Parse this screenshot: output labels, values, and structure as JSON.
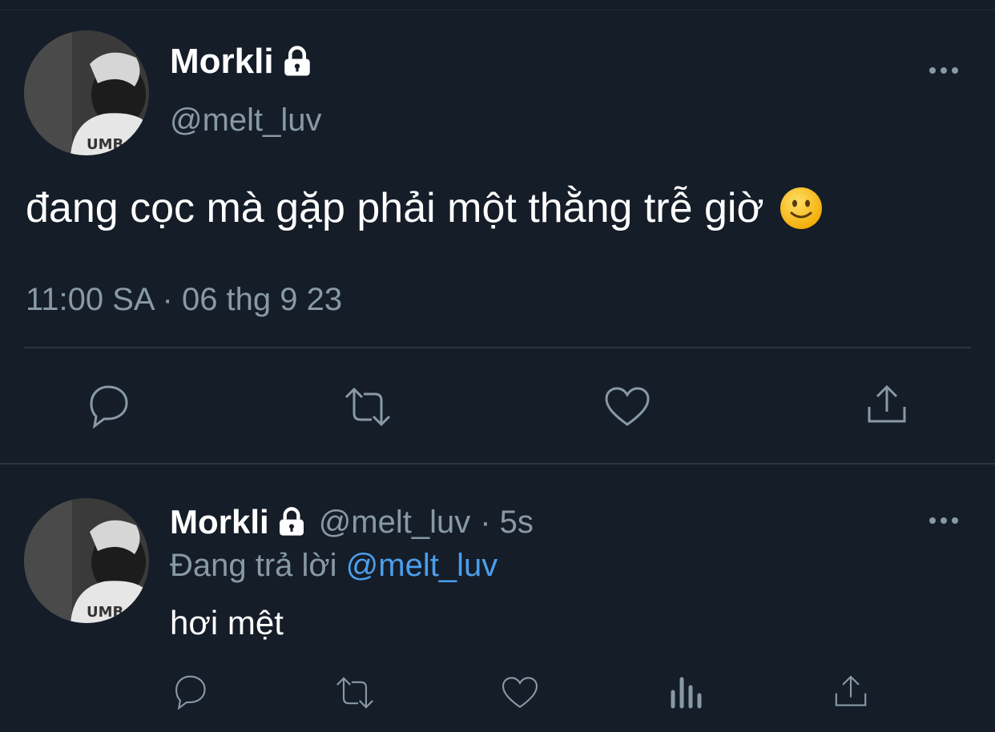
{
  "main_tweet": {
    "display_name": "Morkli",
    "handle": "@melt_luv",
    "text": "đang cọc mà gặp phải một thằng trễ giờ",
    "emoji": "slightly-smiling-face-icon",
    "timestamp": "11:00 SA · 06 thg 9 23",
    "actions": [
      "reply-icon",
      "retweet-icon",
      "like-icon",
      "share-icon"
    ]
  },
  "reply_tweet": {
    "display_name": "Morkli",
    "handle": "@melt_luv",
    "time_ago": "· 5s",
    "replying_prefix": "Đang trả lời",
    "replying_to": "@melt_luv",
    "text": "hơi mệt",
    "actions": [
      "reply-icon",
      "retweet-icon",
      "like-icon",
      "analytics-icon",
      "share-icon"
    ]
  },
  "colors": {
    "background": "#151d28",
    "secondary_text": "#8899a6",
    "link": "#4c9eeb",
    "divider": "#2b3540"
  }
}
